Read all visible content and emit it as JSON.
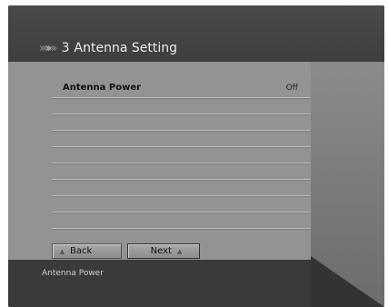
{
  "header": {
    "step": "3",
    "title": "Antenna Setting"
  },
  "list": {
    "rows": [
      {
        "label": "Antenna Power",
        "value": "Off"
      },
      {
        "label": "",
        "value": ""
      },
      {
        "label": "",
        "value": ""
      },
      {
        "label": "",
        "value": ""
      },
      {
        "label": "",
        "value": ""
      },
      {
        "label": "",
        "value": ""
      },
      {
        "label": "",
        "value": ""
      },
      {
        "label": "",
        "value": ""
      },
      {
        "label": "",
        "value": ""
      }
    ]
  },
  "buttons": {
    "back": "Back",
    "next": "Next"
  },
  "footer": {
    "status": "Antenna Power"
  }
}
